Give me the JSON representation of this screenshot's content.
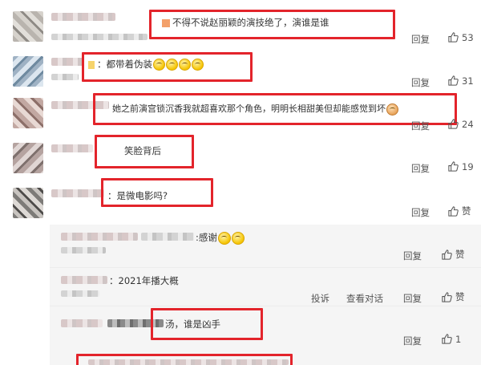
{
  "comments": [
    {
      "text": "不得不说赵丽颖的演技绝了，演谁是谁",
      "reply": "回复",
      "likes": "53"
    },
    {
      "text": "：都带着伪装",
      "reply": "回复",
      "likes": "31"
    },
    {
      "text": "她之前演宫锁沉香我就超喜欢那个角色，明明长相甜美但却能感觉到坏",
      "reply": "回复",
      "likes": "24"
    },
    {
      "text": "笑脸背后",
      "reply": "回复",
      "likes": "19"
    },
    {
      "text": "：是微电影吗?",
      "reply": "回复",
      "likes": "赞"
    }
  ],
  "replies": [
    {
      "text": ":感谢",
      "reply": "回复",
      "likes": "赞"
    },
    {
      "text": "：2021年播大概",
      "report": "投诉",
      "view_thread": "查看对话",
      "reply": "回复",
      "likes": "赞"
    },
    {
      "text": "汤，谁是凶手",
      "reply": "回复",
      "likes": "1"
    }
  ],
  "icons": {
    "like": "thumbs-up-icon",
    "emoji": "smile-emoji-icon"
  },
  "colors": {
    "highlight": "#e3242b"
  }
}
